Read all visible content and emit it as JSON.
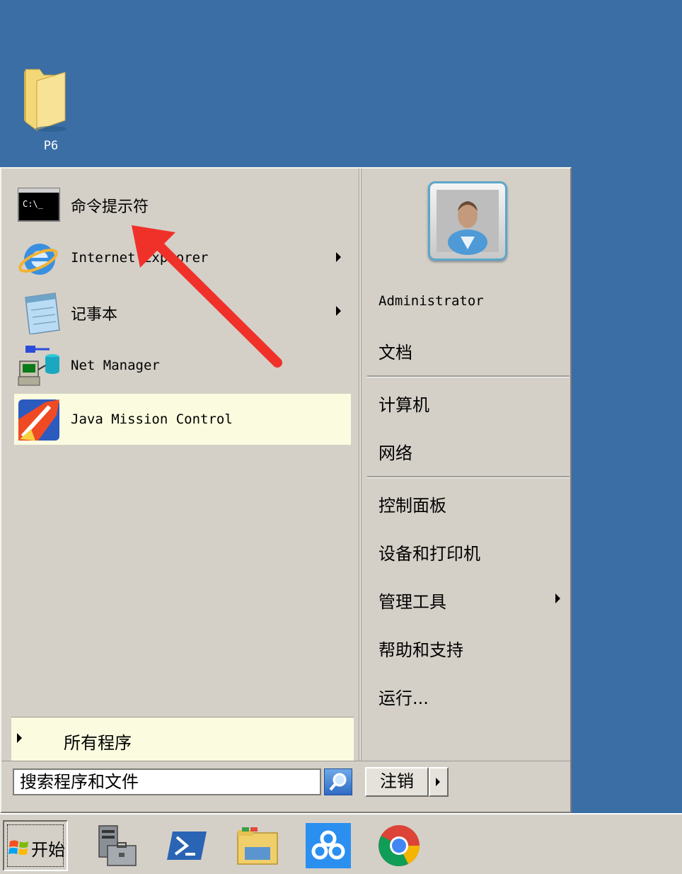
{
  "desktop": {
    "icon_label": "P6",
    "icon": "folder-icon"
  },
  "start_menu": {
    "programs": [
      {
        "label": "命令提示符",
        "icon": "command-prompt-icon",
        "has_submenu": false
      },
      {
        "label": "Internet Explorer",
        "icon": "internet-explorer-icon",
        "has_submenu": true
      },
      {
        "label": "记事本",
        "icon": "notepad-icon",
        "has_submenu": true
      },
      {
        "label": "Net Manager",
        "icon": "net-manager-icon",
        "has_submenu": false
      },
      {
        "label": "Java Mission Control",
        "icon": "java-mission-control-icon",
        "has_submenu": false,
        "highlighted": true
      }
    ],
    "all_programs": "所有程序",
    "user_name": "Administrator",
    "right_items": [
      {
        "label": "文档"
      },
      {
        "label": "计算机"
      },
      {
        "label": "网络"
      },
      {
        "label": "控制面板"
      },
      {
        "label": "设备和打印机"
      },
      {
        "label": "管理工具",
        "has_submenu": true
      },
      {
        "label": "帮助和支持"
      },
      {
        "label": "运行..."
      }
    ],
    "search_placeholder": "搜索程序和文件",
    "logoff_label": "注销"
  },
  "taskbar": {
    "start_label": "开始",
    "pinned": [
      "server-manager-icon",
      "powershell-icon",
      "file-explorer-icon",
      "baidu-netdisk-icon",
      "chrome-icon"
    ]
  },
  "colors": {
    "desktop": "#3a6ea5",
    "menu": "#d4d0c8",
    "highlight": "#fbfbe0",
    "annotation": "#f0312a"
  }
}
